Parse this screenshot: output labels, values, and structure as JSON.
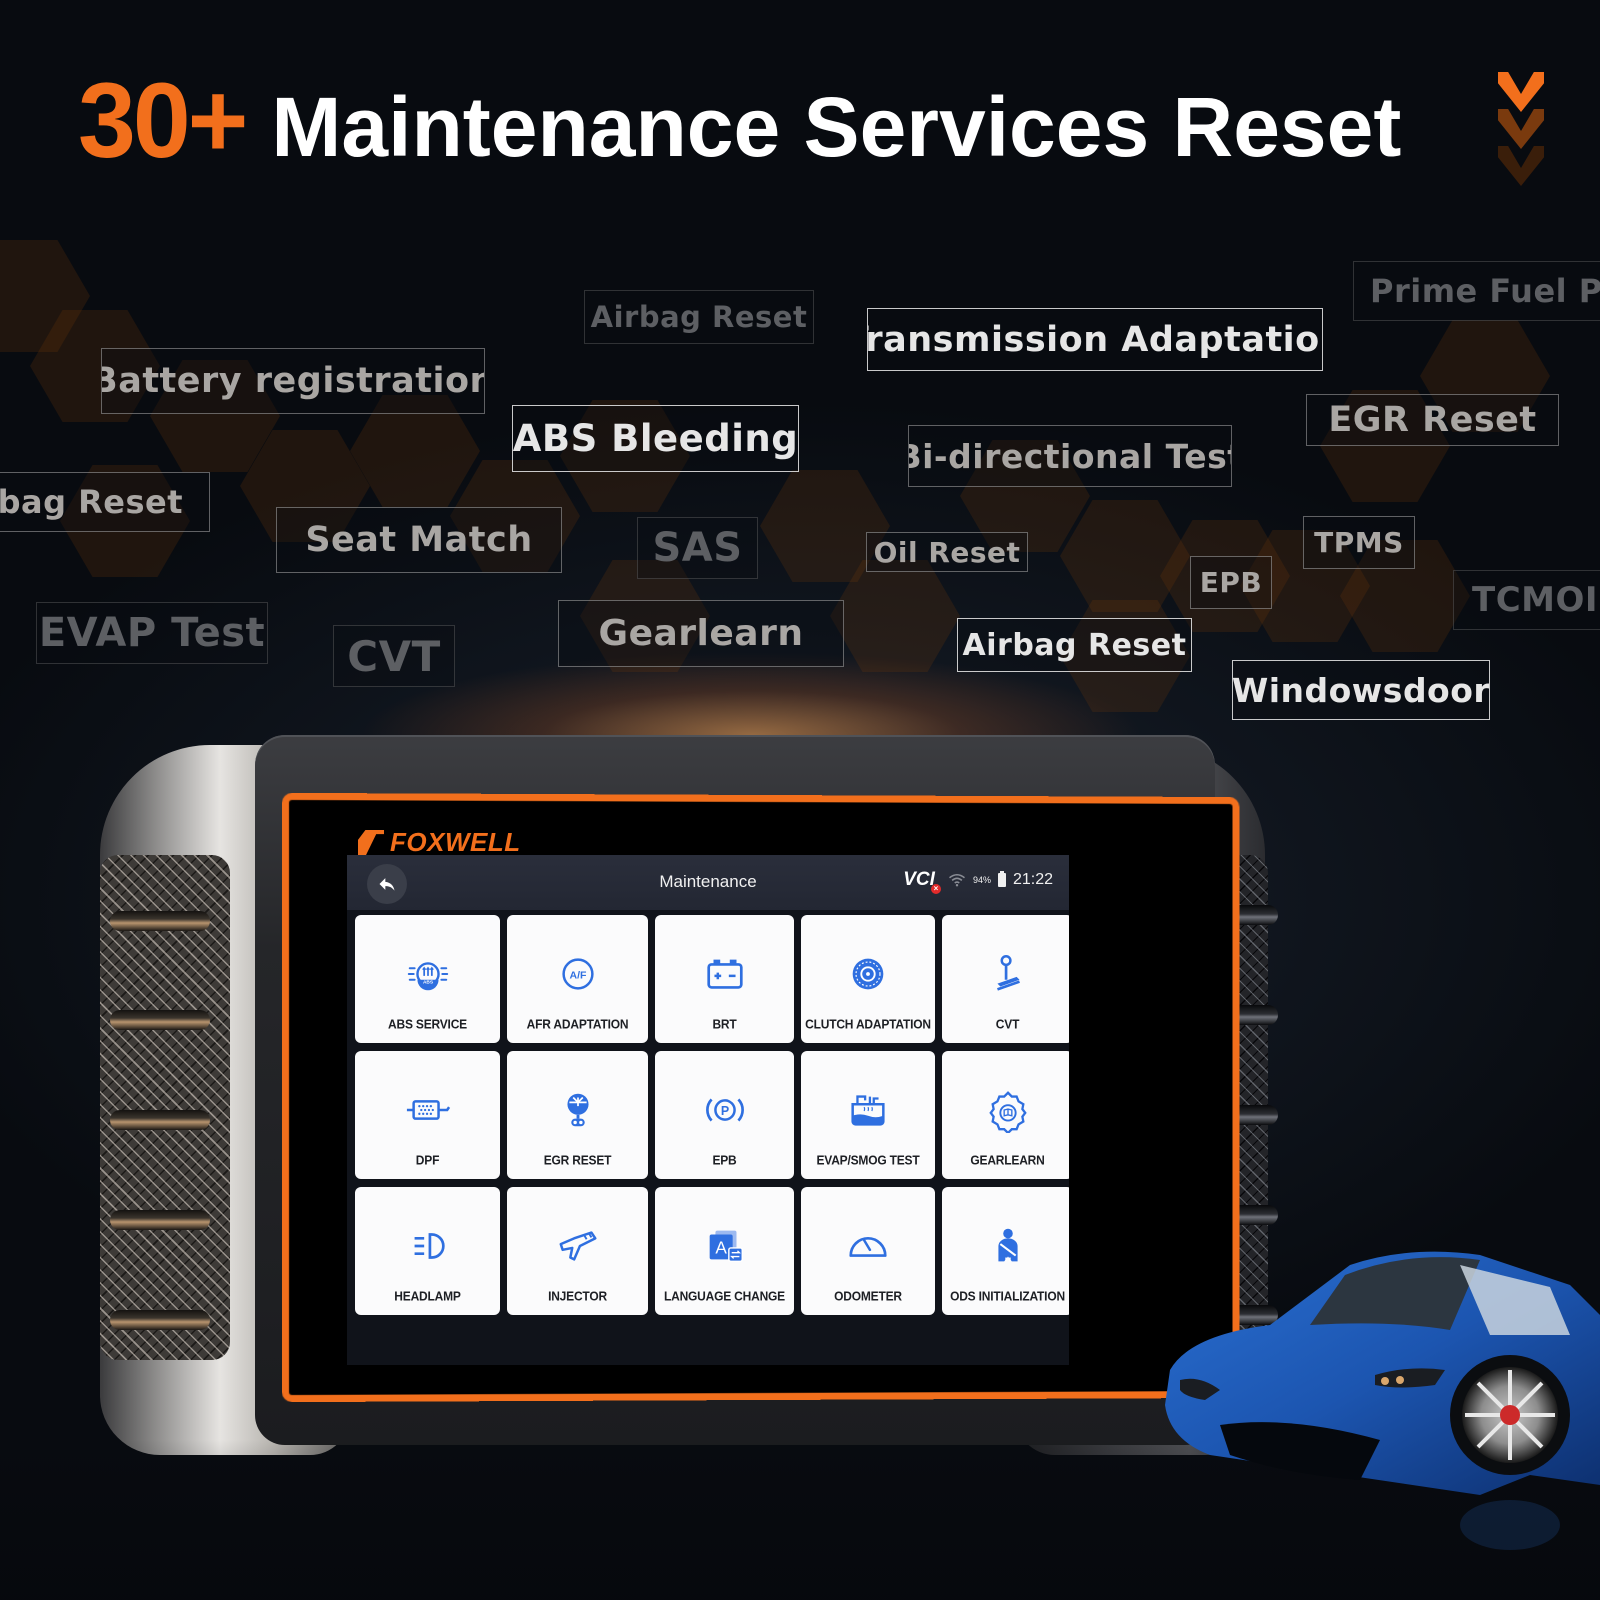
{
  "headline": {
    "count": "30+",
    "title": "Maintenance Services Reset",
    "accent_color": "#f26f1c",
    "scroll_hint_icon": "triple-chevron-down-icon"
  },
  "feature_tags": [
    {
      "label": "Airbag Reset",
      "style": "dim"
    },
    {
      "label": "Transmission Adaptation",
      "style": "bright"
    },
    {
      "label": "Prime Fuel Pur",
      "style": "dim"
    },
    {
      "label": "Battery registration",
      "style": "mid"
    },
    {
      "label": "ABS Bleeding",
      "style": "bright"
    },
    {
      "label": "Bi-directional Test",
      "style": "mid"
    },
    {
      "label": "EGR Reset",
      "style": "mid"
    },
    {
      "label": "irbag Reset",
      "style": "mid"
    },
    {
      "label": "Seat Match",
      "style": "mid"
    },
    {
      "label": "SAS",
      "style": "dim"
    },
    {
      "label": "Oil Reset",
      "style": "mid"
    },
    {
      "label": "EPB",
      "style": "mid"
    },
    {
      "label": "TPMS",
      "style": "mid"
    },
    {
      "label": "TCMOIL",
      "style": "dim"
    },
    {
      "label": "EVAP Test",
      "style": "dim"
    },
    {
      "label": "CVT",
      "style": "dim"
    },
    {
      "label": "Gearlearn",
      "style": "mid"
    },
    {
      "label": "Airbag Reset",
      "style": "bright"
    },
    {
      "label": "Windowsdoor",
      "style": "bright"
    }
  ],
  "device": {
    "brand": "FOXWELL",
    "frame_color": "#f26f1c",
    "screen": {
      "title": "Maintenance",
      "back_icon": "back-arrow-icon",
      "status": {
        "vci_label": "VCI",
        "vci_state": "disconnected",
        "wifi_icon": "wifi-icon",
        "battery_percent": "94%",
        "time": "21:22"
      },
      "icon_color": "#2f6fe0",
      "tiles": [
        {
          "label": "ABS SERVICE",
          "icon": "abs-brake-icon"
        },
        {
          "label": "AFR ADAPTATION",
          "icon": "air-fuel-ratio-icon"
        },
        {
          "label": "BRT",
          "icon": "battery-icon"
        },
        {
          "label": "CLUTCH ADAPTATION",
          "icon": "clutch-disc-icon"
        },
        {
          "label": "CVT",
          "icon": "gear-shifter-icon"
        },
        {
          "label": "DPF",
          "icon": "particulate-filter-icon"
        },
        {
          "label": "EGR RESET",
          "icon": "egr-valve-icon"
        },
        {
          "label": "EPB",
          "icon": "parking-brake-icon"
        },
        {
          "label": "EVAP/SMOG TEST",
          "icon": "fuel-tank-icon"
        },
        {
          "label": "GEARLEARN",
          "icon": "gear-book-icon"
        },
        {
          "label": "HEADLAMP",
          "icon": "headlamp-icon"
        },
        {
          "label": "INJECTOR",
          "icon": "injector-icon"
        },
        {
          "label": "LANGUAGE CHANGE",
          "icon": "language-icon"
        },
        {
          "label": "ODOMETER",
          "icon": "odometer-gauge-icon"
        },
        {
          "label": "ODS INITIALIZATION",
          "icon": "seat-occupant-icon"
        }
      ]
    }
  },
  "car": {
    "color": "#1f5fbf",
    "icon": "sports-car-image"
  }
}
